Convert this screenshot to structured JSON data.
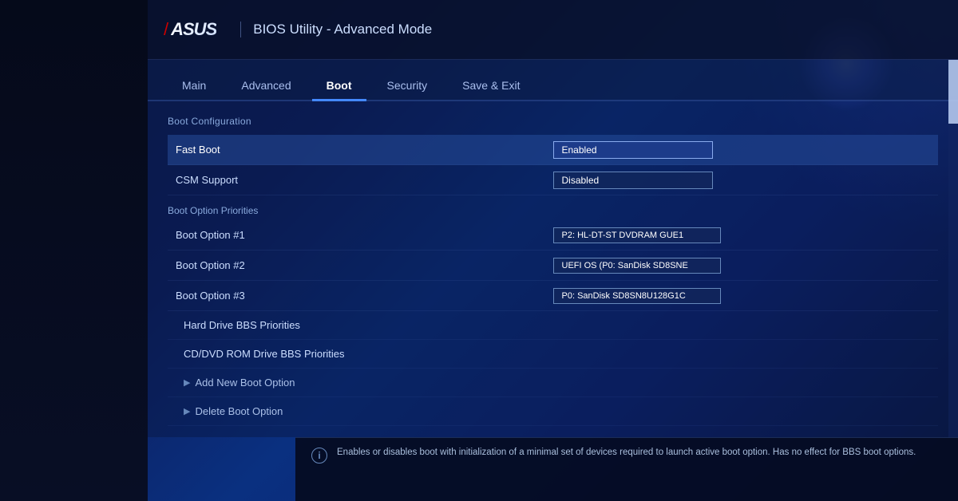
{
  "header": {
    "logo_slash": "/",
    "logo_text": "ASUS",
    "title": "BIOS Utility - Advanced Mode"
  },
  "nav": {
    "tabs": [
      {
        "id": "main",
        "label": "Main",
        "active": false
      },
      {
        "id": "advanced",
        "label": "Advanced",
        "active": false
      },
      {
        "id": "boot",
        "label": "Boot",
        "active": true
      },
      {
        "id": "security",
        "label": "Security",
        "active": false
      },
      {
        "id": "save-exit",
        "label": "Save & Exit",
        "active": false
      }
    ]
  },
  "content": {
    "section1_label": "Boot Configuration",
    "rows": [
      {
        "id": "fast-boot",
        "label": "Fast Boot",
        "value": "Enabled",
        "highlighted": true
      },
      {
        "id": "csm-support",
        "label": "CSM Support",
        "value": "Disabled",
        "highlighted": false
      }
    ],
    "section2_label": "Boot Option Priorities",
    "boot_options": [
      {
        "id": "boot-opt-1",
        "label": "Boot Option #1",
        "value": "P2: HL-DT-ST DVDRAM GUE1"
      },
      {
        "id": "boot-opt-2",
        "label": "Boot Option #2",
        "value": "UEFI OS (P0: SanDisk SD8SNE"
      },
      {
        "id": "boot-opt-3",
        "label": "Boot Option #3",
        "value": "P0: SanDisk SD8SN8U128G1C"
      }
    ],
    "sub_items": [
      {
        "id": "hard-drive-bbs",
        "label": "Hard Drive BBS Priorities"
      },
      {
        "id": "cddvd-bbs",
        "label": "CD/DVD ROM Drive BBS Priorities"
      }
    ],
    "expandable_items": [
      {
        "id": "add-new-boot",
        "label": "Add New Boot Option"
      },
      {
        "id": "delete-boot",
        "label": "Delete Boot Option"
      }
    ]
  },
  "info_bar": {
    "text": "Enables or disables boot with initialization of a minimal set of devices required to launch active boot option. Has no effect for BBS boot options."
  }
}
